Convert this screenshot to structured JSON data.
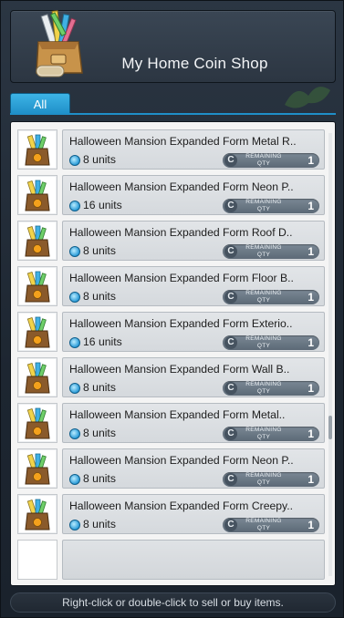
{
  "header": {
    "title": "My Home Coin Shop"
  },
  "tabs": [
    {
      "label": "All",
      "active": true
    }
  ],
  "items": [
    {
      "name": "Halloween Mansion Expanded Form Metal R..",
      "units": "8 units",
      "remaining_label": "REMAINING QTY",
      "remaining_qty": "1"
    },
    {
      "name": "Halloween Mansion Expanded Form Neon P..",
      "units": "16 units",
      "remaining_label": "REMAINING QTY",
      "remaining_qty": "1"
    },
    {
      "name": "Halloween Mansion Expanded Form Roof D..",
      "units": "8 units",
      "remaining_label": "REMAINING QTY",
      "remaining_qty": "1"
    },
    {
      "name": "Halloween Mansion Expanded Form Floor B..",
      "units": "8 units",
      "remaining_label": "REMAINING QTY",
      "remaining_qty": "1"
    },
    {
      "name": "Halloween Mansion Expanded Form Exterio..",
      "units": "16 units",
      "remaining_label": "REMAINING QTY",
      "remaining_qty": "1"
    },
    {
      "name": "Halloween Mansion Expanded Form Wall B..",
      "units": "8 units",
      "remaining_label": "REMAINING QTY",
      "remaining_qty": "1"
    },
    {
      "name": "Halloween Mansion Expanded Form Metal..",
      "units": "8 units",
      "remaining_label": "REMAINING QTY",
      "remaining_qty": "1"
    },
    {
      "name": "Halloween Mansion Expanded Form Neon P..",
      "units": "8 units",
      "remaining_label": "REMAINING QTY",
      "remaining_qty": "1"
    },
    {
      "name": "Halloween Mansion Expanded Form Creepy..",
      "units": "8 units",
      "remaining_label": "REMAINING QTY",
      "remaining_qty": "1"
    }
  ],
  "coin_letter": "C",
  "footer": {
    "hint": "Right-click or double-click to sell or buy items."
  },
  "colors": {
    "accent": "#1f8fc8",
    "window_bg": "#1d2631",
    "panel_bg": "#f4f4f4",
    "badge_bg": "#6b7884"
  },
  "icons": {
    "shop": "shop-box-icon",
    "item": "blueprint-bag-icon",
    "currency": "home-coin-icon"
  }
}
